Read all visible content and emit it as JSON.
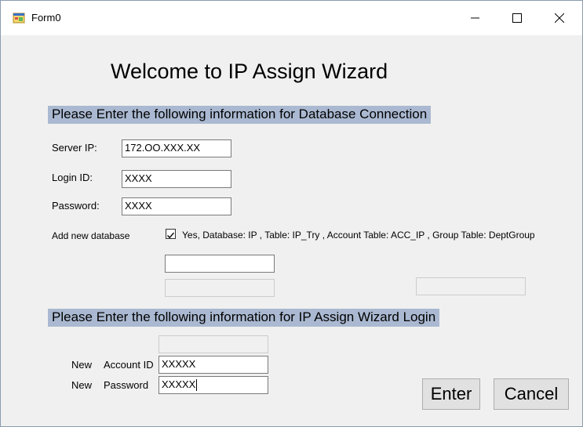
{
  "window": {
    "title": "Form0"
  },
  "heading": "Welcome to IP Assign Wizard",
  "db_section": {
    "title": "Please Enter the following information for Database Connection",
    "server_ip_label": "Server IP:",
    "server_ip_value": "172.OO.XXX.XX",
    "login_id_label": "Login ID:",
    "login_id_value": "XXXX",
    "password_label": "Password:",
    "password_value": "XXXX",
    "add_db_label": "Add new database",
    "add_db_checked": true,
    "add_db_option_text": "Yes, Database: IP , Table: IP_Try  ,  Account Table: ACC_IP  ,  Group Table: DeptGroup"
  },
  "login_section": {
    "title": "Please Enter the following information for IP Assign Wizard Login",
    "new_label_1": "New",
    "account_id_label": "Account ID",
    "account_id_value": "XXXXX",
    "new_label_2": "New",
    "password_label": "Password",
    "password_value": "XXXXX"
  },
  "buttons": {
    "enter": "Enter",
    "cancel": "Cancel"
  },
  "colors": {
    "section_highlight": "#aab9d1",
    "window_bg": "#f0f0f0"
  }
}
